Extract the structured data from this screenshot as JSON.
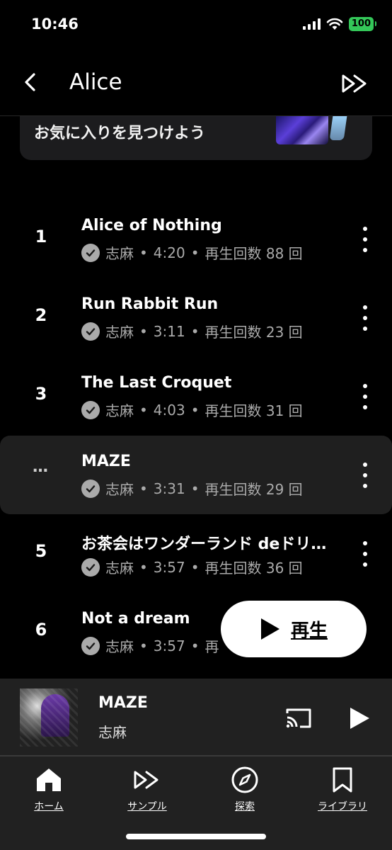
{
  "status_bar": {
    "time": "10:46",
    "battery": "100",
    "icons": [
      "signal-icon",
      "wifi-icon",
      "battery-icon"
    ]
  },
  "header": {
    "title": "Alice",
    "back_icon": "chevron-left-icon",
    "action_icon": "shuffle-icon"
  },
  "banner": {
    "text": "お気に入りを見つけよう"
  },
  "tracks": [
    {
      "number": "1",
      "title": "Alice of Nothing",
      "artist": "志麻",
      "duration": "4:20",
      "plays": "再生回数 88 回"
    },
    {
      "number": "2",
      "title": "Run Rabbit Run",
      "artist": "志麻",
      "duration": "3:11",
      "plays": "再生回数 23 回"
    },
    {
      "number": "3",
      "title": "The Last Croquet",
      "artist": "志麻",
      "duration": "4:03",
      "plays": "再生回数 31 回"
    },
    {
      "number": "…",
      "title": "MAZE",
      "artist": "志麻",
      "duration": "3:31",
      "plays": "再生回数 29 回",
      "active": true
    },
    {
      "number": "5",
      "title": "お茶会はワンダーランド deドリ…",
      "artist": "志麻",
      "duration": "3:57",
      "plays": "再生回数 36 回"
    },
    {
      "number": "6",
      "title": "Not a dream",
      "artist": "志麻",
      "duration": "3:57",
      "plays": "再"
    }
  ],
  "separator": "•",
  "play_fab": {
    "label": "再生",
    "icon": "play-icon"
  },
  "mini_player": {
    "title": "MAZE",
    "artist": "志麻",
    "cast_icon": "cast-icon",
    "play_icon": "play-icon"
  },
  "bottom_nav": [
    {
      "label": "ホーム",
      "icon": "home-icon"
    },
    {
      "label": "サンプル",
      "icon": "samples-icon"
    },
    {
      "label": "探索",
      "icon": "compass-icon"
    },
    {
      "label": "ライブラリ",
      "icon": "library-icon"
    }
  ],
  "colors": {
    "background": "#000000",
    "surface": "#212121",
    "active_row": "#1f1f1f",
    "battery": "#34c759",
    "meta_text": "#aaaaaa"
  }
}
